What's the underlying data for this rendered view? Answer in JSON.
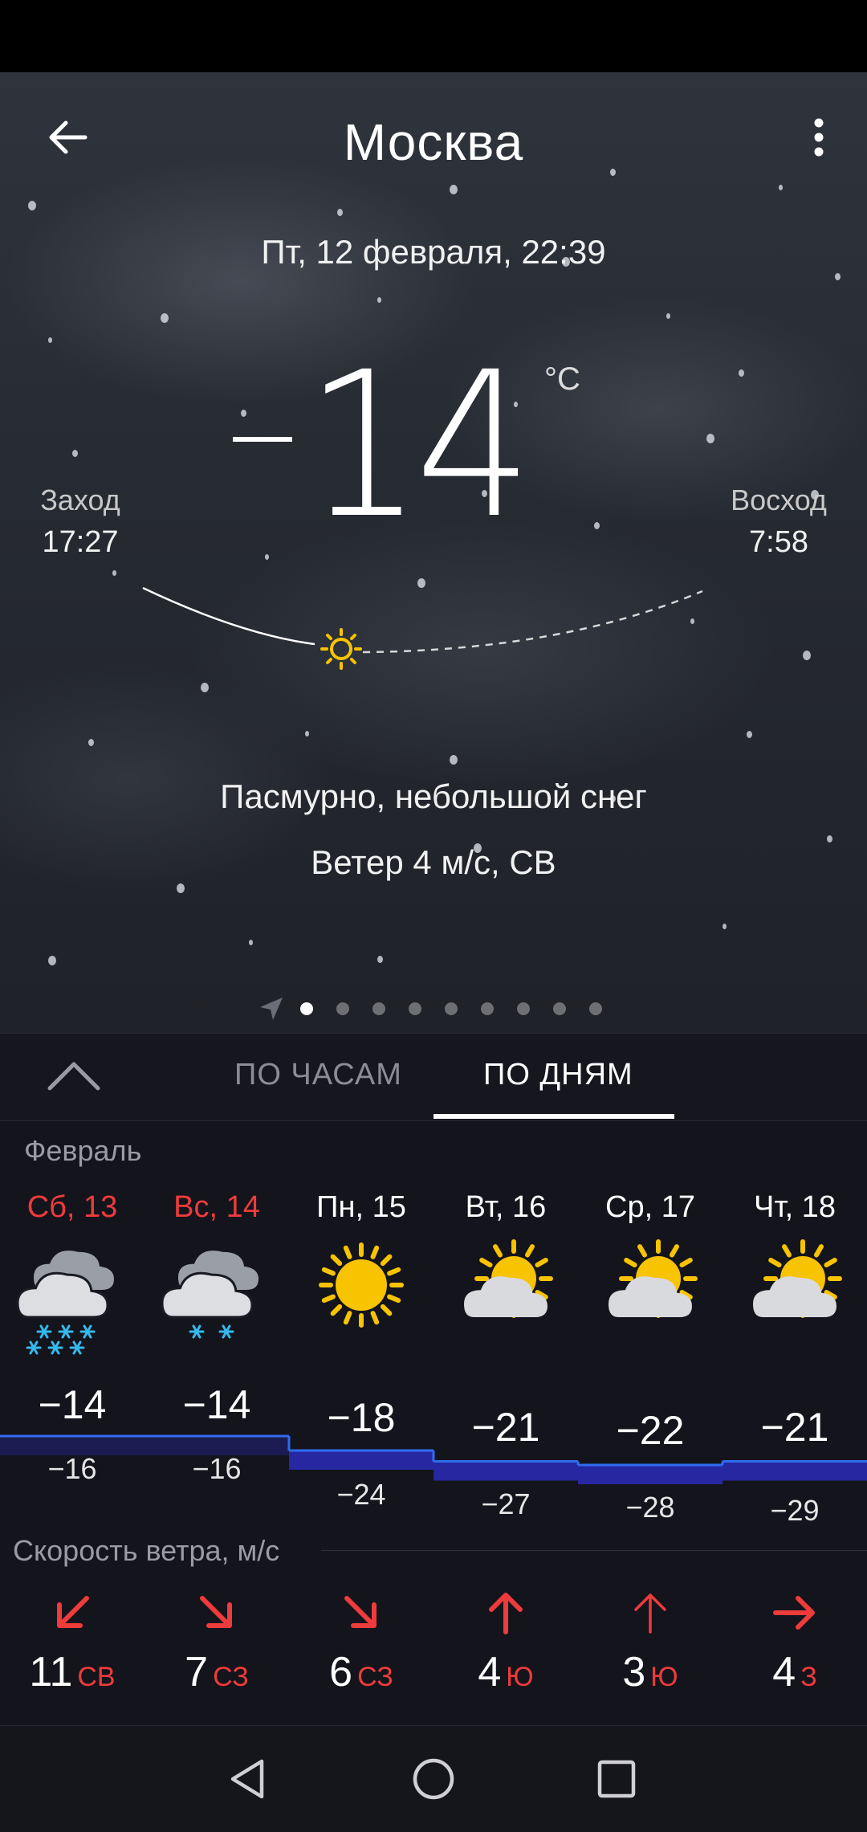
{
  "header": {
    "city": "Москва",
    "back_icon": "arrow-left-icon",
    "menu_icon": "more-vertical-icon"
  },
  "current": {
    "datetime": "Пт, 12 февраля, 22:39",
    "temperature": "14",
    "temperature_sign": "−",
    "unit": "°C",
    "sunset_label": "Заход",
    "sunset_time": "17:27",
    "sunrise_label": "Восход",
    "sunrise_time": "7:58",
    "condition": "Пасмурно, небольшой снег",
    "wind": "Ветер 4 м/с, СВ"
  },
  "pager": {
    "pages": 9,
    "active_index": 0
  },
  "tabs": {
    "hourly": "ПО ЧАСАМ",
    "daily": "ПО ДНЯМ",
    "active": "daily"
  },
  "month_label": "Февраль",
  "days": [
    {
      "name": "Сб, 13",
      "weekend": true,
      "icon": "cloud-heavy-snow-icon",
      "high": "−14",
      "low": "−16"
    },
    {
      "name": "Вс, 14",
      "weekend": true,
      "icon": "cloud-light-snow-icon",
      "high": "−14",
      "low": "−16"
    },
    {
      "name": "Пн, 15",
      "weekend": false,
      "icon": "sun-icon",
      "high": "−18",
      "low": "−24"
    },
    {
      "name": "Вт, 16",
      "weekend": false,
      "icon": "partly-cloudy-icon",
      "high": "−21",
      "low": "−27"
    },
    {
      "name": "Ср, 17",
      "weekend": false,
      "icon": "partly-cloudy-icon",
      "high": "−22",
      "low": "−28"
    },
    {
      "name": "Чт, 18",
      "weekend": false,
      "icon": "partly-cloudy-icon",
      "high": "−21",
      "low": "−29"
    }
  ],
  "wind_section": {
    "title": "Скорость ветра, м/с",
    "items": [
      {
        "speed": "11",
        "dir": "СВ",
        "arrow": "arrow-down-left-icon"
      },
      {
        "speed": "7",
        "dir": "СЗ",
        "arrow": "arrow-down-right-icon"
      },
      {
        "speed": "6",
        "dir": "СЗ",
        "arrow": "arrow-down-right-icon"
      },
      {
        "speed": "4",
        "dir": "Ю",
        "arrow": "arrow-up-icon"
      },
      {
        "speed": "3",
        "dir": "Ю",
        "arrow": "arrow-up-icon"
      },
      {
        "speed": "4",
        "dir": "З",
        "arrow": "arrow-right-icon"
      }
    ]
  },
  "colors": {
    "weekend": "#ee3b3b",
    "wind_arrow": "#ee3b3b",
    "sun": "#f8c300",
    "snow": "#35b8ec",
    "graph_line": "#2f6cf0",
    "graph_fill": "#2a2ab8"
  }
}
